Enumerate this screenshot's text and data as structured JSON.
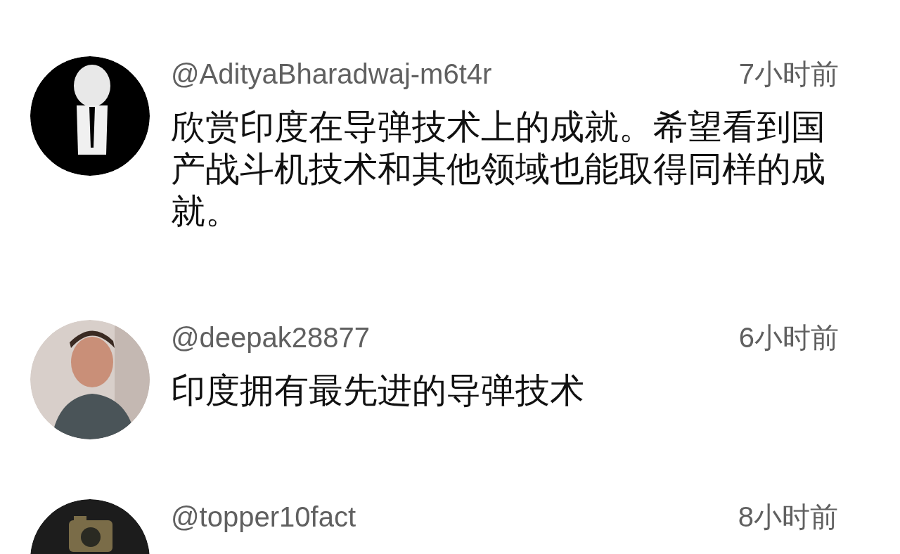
{
  "comments": [
    {
      "author": "@AdityaBharadwaj-m6t4r",
      "time": "7小时前",
      "text": "欣赏印度在导弹技术上的成就。希望看到国产战斗机技术和其他领域也能取得同样的成就。"
    },
    {
      "author": "@deepak28877",
      "time": "6小时前",
      "text": "印度拥有最先进的导弹技术"
    },
    {
      "author": "@topper10fact",
      "time": "8小时前"
    }
  ]
}
